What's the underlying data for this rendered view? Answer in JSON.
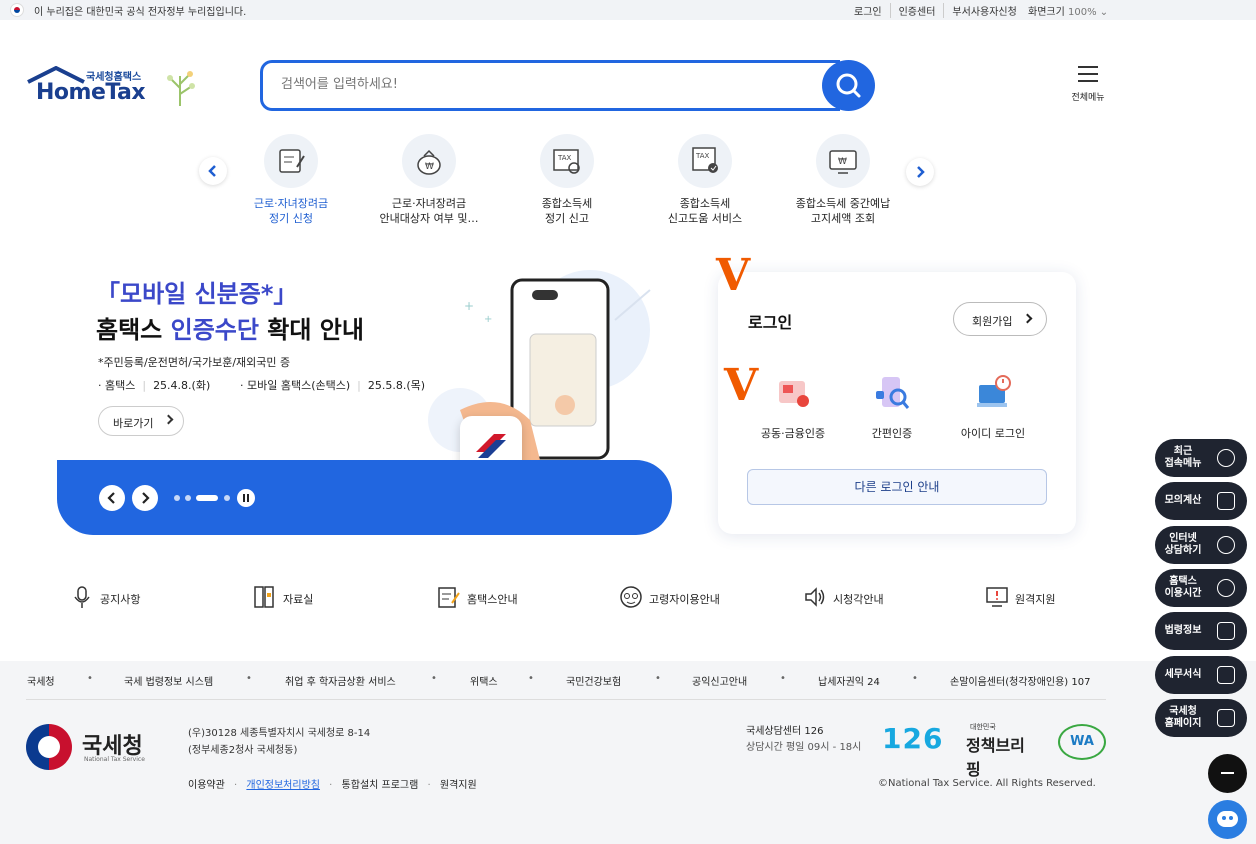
{
  "gov_bar": {
    "notice": "이 누리집은 대한민국 공식 전자정부 누리집입니다.",
    "links": [
      "로그인",
      "인증센터",
      "부서사용자신청"
    ],
    "font_size_label": "화면크기",
    "font_size_value": "100%"
  },
  "header": {
    "logo_sub": "국세청홈택스",
    "logo_main": "HomeTax",
    "search_placeholder": "검색어를 입력하세요!",
    "menu_label": "전체메뉴"
  },
  "quick_services": [
    {
      "line1": "근로·자녀장려금",
      "line2": "정기 신청",
      "icon": "document-edit-icon",
      "active": true
    },
    {
      "line1": "근로·자녀장려금",
      "line2": "안내대상자 여부 및…",
      "icon": "money-bag-icon",
      "active": false
    },
    {
      "line1": "종합소득세",
      "line2": "정기 신고",
      "icon": "tax-search-icon",
      "active": false
    },
    {
      "line1": "종합소득세",
      "line2": "신고도움 서비스",
      "icon": "tax-check-icon",
      "active": false
    },
    {
      "line1": "종합소득세 중간예납",
      "line2": "고지세액 조회",
      "icon": "tax-monitor-icon",
      "active": false
    }
  ],
  "banner": {
    "headline1": "「모바일 신분증*」",
    "headline2_pre": "홈택스 ",
    "headline2_hl": "인증수단",
    "headline2_post": " 확대 안내",
    "note": "*주민등록/운전면허/국가보훈/재외국민 증",
    "date1_label": "· 홈택스",
    "date1_value": "25.4.8.(화)",
    "date2_label": "· 모바일 홈택스(손택스)",
    "date2_value": "25.5.8.(목)",
    "go_button": "바로가기"
  },
  "login": {
    "title": "로그인",
    "join_button": "회원가입",
    "options": [
      {
        "label": "공동·금융인증",
        "icon": "certificate-card-icon"
      },
      {
        "label": "간편인증",
        "icon": "simple-auth-icon"
      },
      {
        "label": "아이디 로그인",
        "icon": "id-login-icon"
      }
    ],
    "other_login": "다른 로그인 안내",
    "check_mark": "V"
  },
  "quick_links": [
    {
      "label": "공지사항",
      "icon": "microphone-icon"
    },
    {
      "label": "자료실",
      "icon": "archive-icon"
    },
    {
      "label": "홈택스안내",
      "icon": "guide-edit-icon"
    },
    {
      "label": "고령자이용안내",
      "icon": "senior-icon"
    },
    {
      "label": "시청각안내",
      "icon": "speaker-icon"
    },
    {
      "label": "원격지원",
      "icon": "remote-support-icon"
    }
  ],
  "footer": {
    "sitemap": [
      "국세청",
      "국세 법령정보 시스템",
      "취업 후 학자금상환 서비스",
      "위택스",
      "국민건강보험",
      "공익신고안내",
      "납세자권익 24",
      "손말이음센터(청각장애인용) 107"
    ],
    "org_name": "국세청",
    "org_eng": "National Tax Service",
    "address1": "(우)30128 세종특별자치시 국세청로 8-14",
    "address2": "(정부세종2청사 국세청동)",
    "links": [
      "이용약관",
      "개인정보처리방침",
      "통합설치 프로그램",
      "원격지원"
    ],
    "center_title": "국세상담센터 126",
    "center_hours": "상담시간 평일 09시 - 18시",
    "badge_126": "126",
    "policy_small": "대한민국",
    "policy_big": "정책브리핑",
    "wa_mark": "WA",
    "copyright": "©National Tax Service. All Rights Reserved."
  },
  "float_menu": [
    {
      "line1": "최근",
      "line2": "접속메뉴"
    },
    {
      "line1": "모의계산",
      "line2": ""
    },
    {
      "line1": "인터넷",
      "line2": "상담하기"
    },
    {
      "line1": "홈택스",
      "line2": "이용시간"
    },
    {
      "line1": "법령정보",
      "line2": ""
    },
    {
      "line1": "세무서식",
      "line2": ""
    },
    {
      "line1": "국세청",
      "line2": "홈페이지"
    }
  ],
  "colors": {
    "primary": "#2166e0",
    "accent_purple": "#3b48c9",
    "check_orange": "#f05a00",
    "float_dark": "#1f2430"
  }
}
